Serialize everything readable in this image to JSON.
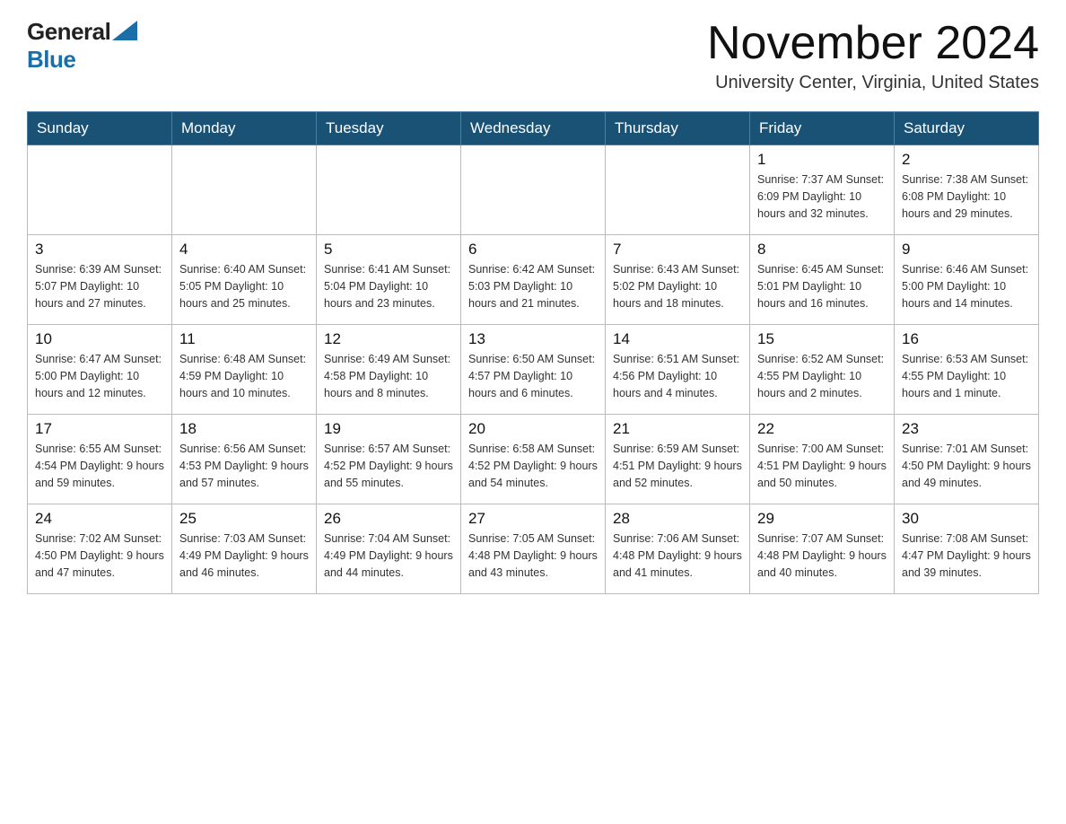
{
  "header": {
    "logo_general": "General",
    "logo_blue": "Blue",
    "month_title": "November 2024",
    "location": "University Center, Virginia, United States"
  },
  "calendar": {
    "days_of_week": [
      "Sunday",
      "Monday",
      "Tuesday",
      "Wednesday",
      "Thursday",
      "Friday",
      "Saturday"
    ],
    "weeks": [
      [
        {
          "day": "",
          "info": ""
        },
        {
          "day": "",
          "info": ""
        },
        {
          "day": "",
          "info": ""
        },
        {
          "day": "",
          "info": ""
        },
        {
          "day": "",
          "info": ""
        },
        {
          "day": "1",
          "info": "Sunrise: 7:37 AM\nSunset: 6:09 PM\nDaylight: 10 hours\nand 32 minutes."
        },
        {
          "day": "2",
          "info": "Sunrise: 7:38 AM\nSunset: 6:08 PM\nDaylight: 10 hours\nand 29 minutes."
        }
      ],
      [
        {
          "day": "3",
          "info": "Sunrise: 6:39 AM\nSunset: 5:07 PM\nDaylight: 10 hours\nand 27 minutes."
        },
        {
          "day": "4",
          "info": "Sunrise: 6:40 AM\nSunset: 5:05 PM\nDaylight: 10 hours\nand 25 minutes."
        },
        {
          "day": "5",
          "info": "Sunrise: 6:41 AM\nSunset: 5:04 PM\nDaylight: 10 hours\nand 23 minutes."
        },
        {
          "day": "6",
          "info": "Sunrise: 6:42 AM\nSunset: 5:03 PM\nDaylight: 10 hours\nand 21 minutes."
        },
        {
          "day": "7",
          "info": "Sunrise: 6:43 AM\nSunset: 5:02 PM\nDaylight: 10 hours\nand 18 minutes."
        },
        {
          "day": "8",
          "info": "Sunrise: 6:45 AM\nSunset: 5:01 PM\nDaylight: 10 hours\nand 16 minutes."
        },
        {
          "day": "9",
          "info": "Sunrise: 6:46 AM\nSunset: 5:00 PM\nDaylight: 10 hours\nand 14 minutes."
        }
      ],
      [
        {
          "day": "10",
          "info": "Sunrise: 6:47 AM\nSunset: 5:00 PM\nDaylight: 10 hours\nand 12 minutes."
        },
        {
          "day": "11",
          "info": "Sunrise: 6:48 AM\nSunset: 4:59 PM\nDaylight: 10 hours\nand 10 minutes."
        },
        {
          "day": "12",
          "info": "Sunrise: 6:49 AM\nSunset: 4:58 PM\nDaylight: 10 hours\nand 8 minutes."
        },
        {
          "day": "13",
          "info": "Sunrise: 6:50 AM\nSunset: 4:57 PM\nDaylight: 10 hours\nand 6 minutes."
        },
        {
          "day": "14",
          "info": "Sunrise: 6:51 AM\nSunset: 4:56 PM\nDaylight: 10 hours\nand 4 minutes."
        },
        {
          "day": "15",
          "info": "Sunrise: 6:52 AM\nSunset: 4:55 PM\nDaylight: 10 hours\nand 2 minutes."
        },
        {
          "day": "16",
          "info": "Sunrise: 6:53 AM\nSunset: 4:55 PM\nDaylight: 10 hours\nand 1 minute."
        }
      ],
      [
        {
          "day": "17",
          "info": "Sunrise: 6:55 AM\nSunset: 4:54 PM\nDaylight: 9 hours\nand 59 minutes."
        },
        {
          "day": "18",
          "info": "Sunrise: 6:56 AM\nSunset: 4:53 PM\nDaylight: 9 hours\nand 57 minutes."
        },
        {
          "day": "19",
          "info": "Sunrise: 6:57 AM\nSunset: 4:52 PM\nDaylight: 9 hours\nand 55 minutes."
        },
        {
          "day": "20",
          "info": "Sunrise: 6:58 AM\nSunset: 4:52 PM\nDaylight: 9 hours\nand 54 minutes."
        },
        {
          "day": "21",
          "info": "Sunrise: 6:59 AM\nSunset: 4:51 PM\nDaylight: 9 hours\nand 52 minutes."
        },
        {
          "day": "22",
          "info": "Sunrise: 7:00 AM\nSunset: 4:51 PM\nDaylight: 9 hours\nand 50 minutes."
        },
        {
          "day": "23",
          "info": "Sunrise: 7:01 AM\nSunset: 4:50 PM\nDaylight: 9 hours\nand 49 minutes."
        }
      ],
      [
        {
          "day": "24",
          "info": "Sunrise: 7:02 AM\nSunset: 4:50 PM\nDaylight: 9 hours\nand 47 minutes."
        },
        {
          "day": "25",
          "info": "Sunrise: 7:03 AM\nSunset: 4:49 PM\nDaylight: 9 hours\nand 46 minutes."
        },
        {
          "day": "26",
          "info": "Sunrise: 7:04 AM\nSunset: 4:49 PM\nDaylight: 9 hours\nand 44 minutes."
        },
        {
          "day": "27",
          "info": "Sunrise: 7:05 AM\nSunset: 4:48 PM\nDaylight: 9 hours\nand 43 minutes."
        },
        {
          "day": "28",
          "info": "Sunrise: 7:06 AM\nSunset: 4:48 PM\nDaylight: 9 hours\nand 41 minutes."
        },
        {
          "day": "29",
          "info": "Sunrise: 7:07 AM\nSunset: 4:48 PM\nDaylight: 9 hours\nand 40 minutes."
        },
        {
          "day": "30",
          "info": "Sunrise: 7:08 AM\nSunset: 4:47 PM\nDaylight: 9 hours\nand 39 minutes."
        }
      ]
    ]
  }
}
